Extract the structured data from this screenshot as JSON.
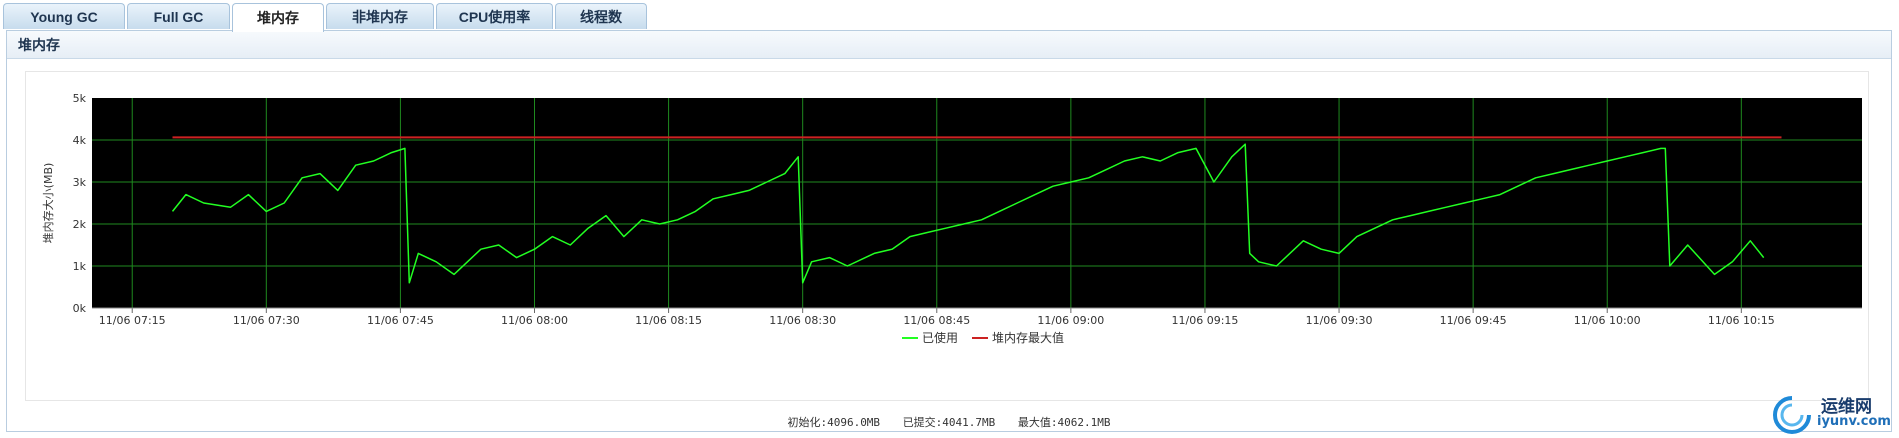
{
  "tabs": [
    {
      "label": "Young GC",
      "active": false
    },
    {
      "label": "Full GC",
      "active": false
    },
    {
      "label": "堆内存",
      "active": true
    },
    {
      "label": "非堆内存",
      "active": false
    },
    {
      "label": "CPU使用率",
      "active": false
    },
    {
      "label": "线程数",
      "active": false
    }
  ],
  "panel": {
    "title": "堆内存"
  },
  "stats": {
    "init": "初始化:4096.0MB",
    "committed": "已提交:4041.7MB",
    "max": "最大值:4062.1MB"
  },
  "watermark": {
    "title": "运维网",
    "url": "iyunv.com"
  },
  "colors": {
    "used": "#22ff22",
    "max": "#cc2222",
    "plot_bg": "#000000",
    "grid": "#1f8a1f"
  },
  "chart_data": {
    "type": "line",
    "ylabel": "堆内存大小(MB)",
    "ylim": [
      0,
      5000
    ],
    "y_ticks": [
      0,
      1000,
      2000,
      3000,
      4000,
      5000
    ],
    "y_tick_labels": [
      "0k",
      "1k",
      "2k",
      "3k",
      "4k",
      "5k"
    ],
    "x_ticks_min": [
      435,
      450,
      465,
      480,
      495,
      510,
      525,
      540,
      555,
      570,
      585,
      600,
      615
    ],
    "x_tick_labels": [
      "11/06 07:15",
      "11/06 07:30",
      "11/06 07:45",
      "11/06 08:00",
      "11/06 08:15",
      "11/06 08:30",
      "11/06 08:45",
      "11/06 09:00",
      "11/06 09:15",
      "11/06 09:30",
      "11/06 09:45",
      "11/06 10:00",
      "11/06 10:15"
    ],
    "x_range_min": [
      430.5,
      628.5
    ],
    "legend": [
      "已使用",
      "堆内存最大值"
    ],
    "series": [
      {
        "name": "已使用",
        "x_min": [
          439.5,
          441,
          443,
          446,
          448,
          450,
          452,
          454,
          456,
          458,
          460,
          462,
          464,
          465.5,
          466,
          467,
          469,
          471,
          474,
          476,
          478,
          480,
          482,
          484,
          486,
          488,
          490,
          492,
          494,
          496,
          498,
          500,
          502,
          504,
          506,
          508,
          509.5,
          510,
          511,
          513,
          515,
          518,
          520,
          522,
          524,
          526,
          528,
          530,
          532,
          534,
          536,
          538,
          540,
          542,
          544,
          546,
          548,
          550,
          552,
          554,
          556,
          558,
          559.5,
          560,
          561,
          563,
          566,
          568,
          570,
          572,
          574,
          576,
          578,
          580,
          582,
          584,
          586,
          588,
          590,
          592,
          594,
          596,
          598,
          600,
          602,
          604,
          606,
          606.5,
          607,
          609,
          612,
          614,
          616,
          617.5
        ],
        "values": [
          2300,
          2700,
          2500,
          2400,
          2700,
          2300,
          2500,
          3100,
          3200,
          2800,
          3400,
          3500,
          3700,
          3800,
          600,
          1300,
          1100,
          800,
          1400,
          1500,
          1200,
          1400,
          1700,
          1500,
          1900,
          2200,
          1700,
          2100,
          2000,
          2100,
          2300,
          2600,
          2700,
          2800,
          3000,
          3200,
          3600,
          600,
          1100,
          1200,
          1000,
          1300,
          1400,
          1700,
          1800,
          1900,
          2000,
          2100,
          2300,
          2500,
          2700,
          2900,
          3000,
          3100,
          3300,
          3500,
          3600,
          3500,
          3700,
          3800,
          3000,
          3600,
          3900,
          1300,
          1100,
          1000,
          1600,
          1400,
          1300,
          1700,
          1900,
          2100,
          2200,
          2300,
          2400,
          2500,
          2600,
          2700,
          2900,
          3100,
          3200,
          3300,
          3400,
          3500,
          3600,
          3700,
          3800,
          3800,
          1000,
          1500,
          800,
          1100,
          1600,
          1200
        ]
      },
      {
        "name": "堆内存最大值",
        "x_min": [
          439.5,
          619.5
        ],
        "values": [
          4062,
          4062
        ]
      }
    ]
  }
}
